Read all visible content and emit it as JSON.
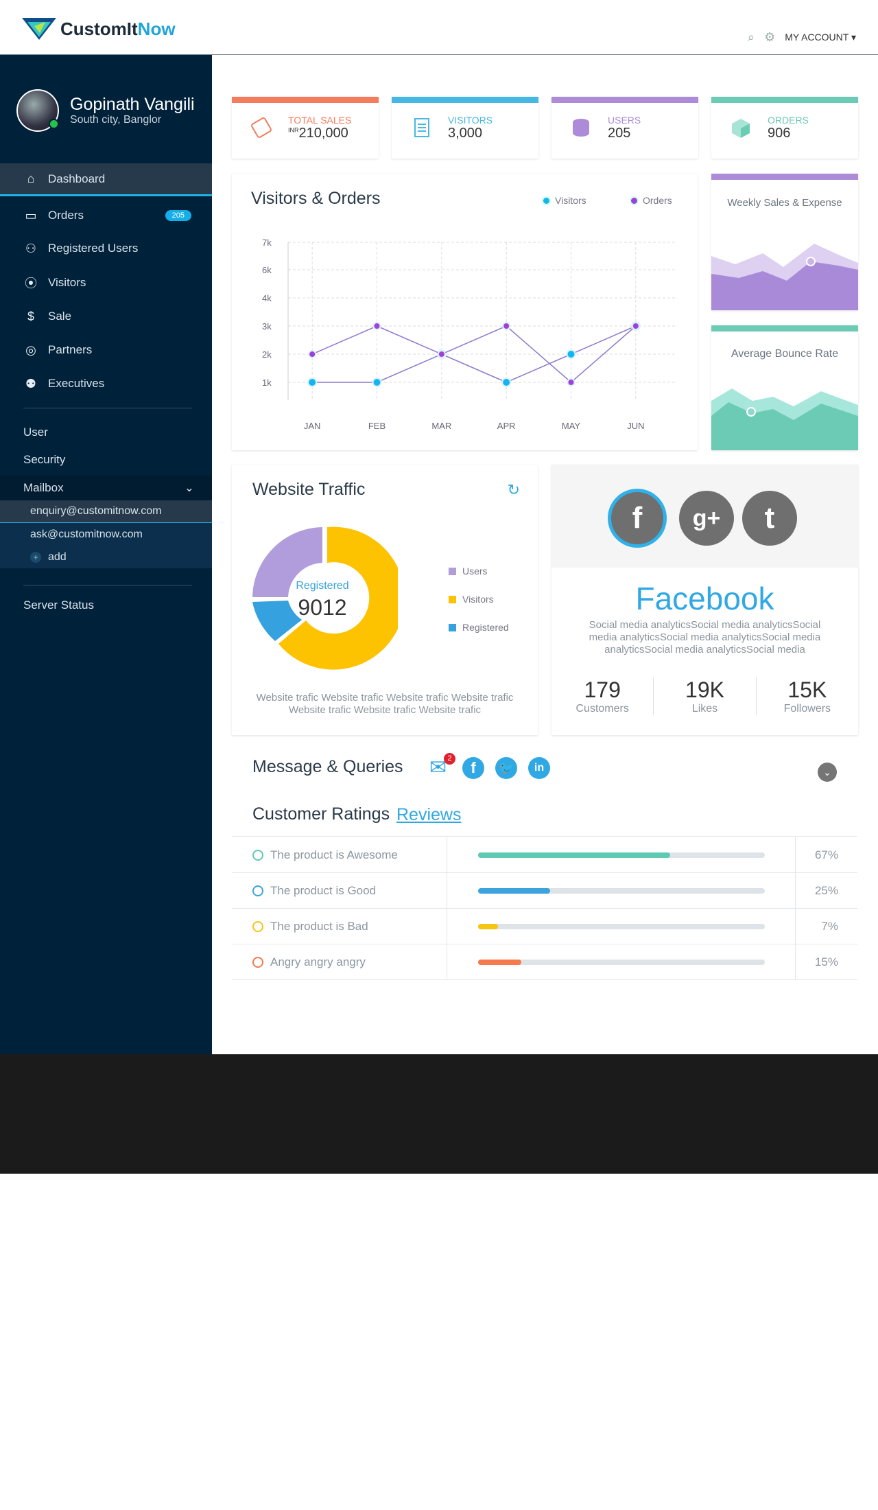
{
  "header": {
    "brand_a": "CustomIt",
    "brand_b": "Now",
    "account": "MY ACCOUNT"
  },
  "profile": {
    "name": "Gopinath Vangili",
    "location": "South city, Banglor"
  },
  "sidebar": {
    "items": [
      {
        "label": "Dashboard",
        "icon": "home-icon"
      },
      {
        "label": "Orders",
        "icon": "chat-icon",
        "badge": "205"
      },
      {
        "label": "Registered Users",
        "icon": "users-icon"
      },
      {
        "label": "Visitors",
        "icon": "location-pin-icon"
      },
      {
        "label": "Sale",
        "icon": "dollar-icon"
      },
      {
        "label": "Partners",
        "icon": "target-icon"
      },
      {
        "label": "Executives",
        "icon": "group-icon"
      }
    ],
    "user": "User",
    "security": "Security",
    "mailbox": "Mailbox",
    "mails": [
      "enquiry@customitnow.com",
      "ask@customitnow.com"
    ],
    "add": "add",
    "server_status": "Server Status"
  },
  "stats": [
    {
      "label": "TOTAL SALES",
      "prefix": "INR",
      "value": "210,000",
      "color": "#f47c5c"
    },
    {
      "label": "VISITORS",
      "prefix": "",
      "value": "3,000",
      "color": "#47b8e3"
    },
    {
      "label": "USERS",
      "prefix": "",
      "value": "205",
      "color": "#ae8bd9"
    },
    {
      "label": "ORDERS",
      "prefix": "",
      "value": "906",
      "color": "#6ccbb5"
    }
  ],
  "visitors_orders": {
    "title": "Visitors & Orders",
    "legend_visitors": "Visitors",
    "legend_orders": "Orders"
  },
  "chart_data": {
    "type": "line",
    "categories": [
      "JAN",
      "FEB",
      "MAR",
      "APR",
      "MAY",
      "JUN"
    ],
    "ytick_labels": [
      "7k",
      "6k",
      "4k",
      "3k",
      "2k",
      "1k"
    ],
    "series": [
      {
        "name": "Visitors",
        "color": "#15b6f0",
        "values": [
          1000,
          1000,
          2000,
          1000,
          2000,
          3000
        ]
      },
      {
        "name": "Orders",
        "color": "#a040d8",
        "values": [
          2000,
          3000,
          2000,
          3000,
          1000,
          3000
        ]
      }
    ]
  },
  "weekly": {
    "title": "Weekly Sales & Expense"
  },
  "bounce": {
    "title": "Average Bounce Rate"
  },
  "traffic": {
    "title": "Website Traffic",
    "center_label": "Registered",
    "center_value": "9012",
    "legend": [
      "Users",
      "Visitors",
      "Registered"
    ],
    "footer": "Website trafic  Website trafic  Website trafic  Website trafic  Website trafic  Website trafic  Website trafic"
  },
  "social": {
    "name": "Facebook",
    "desc": "Social media analyticsSocial media analyticsSocial media analyticsSocial media analyticsSocial media analyticsSocial media analyticsSocial media",
    "stats": [
      {
        "value": "179",
        "label": "Customers"
      },
      {
        "value": "19K",
        "label": "Likes"
      },
      {
        "value": "15K",
        "label": "Followers"
      }
    ]
  },
  "messages": {
    "title": "Message & Queries",
    "mail_count": "2"
  },
  "ratings": {
    "title": "Customer Ratings",
    "link": "Reviews",
    "rows": [
      {
        "label": "The product is Awesome",
        "pct": "67%",
        "value": 0.67,
        "color": "#5fc9b3",
        "face": "#5fc9b3"
      },
      {
        "label": "The product is Good",
        "pct": "25%",
        "value": 0.25,
        "color": "#3ca3dc",
        "face": "#3ca3dc"
      },
      {
        "label": "The product is Bad",
        "pct": "7%",
        "value": 0.07,
        "color": "#f5c511",
        "face": "#f5c511"
      },
      {
        "label": "Angry angry angry",
        "pct": "15%",
        "value": 0.15,
        "color": "#f57a4c",
        "face": "#f57a4c"
      }
    ]
  }
}
